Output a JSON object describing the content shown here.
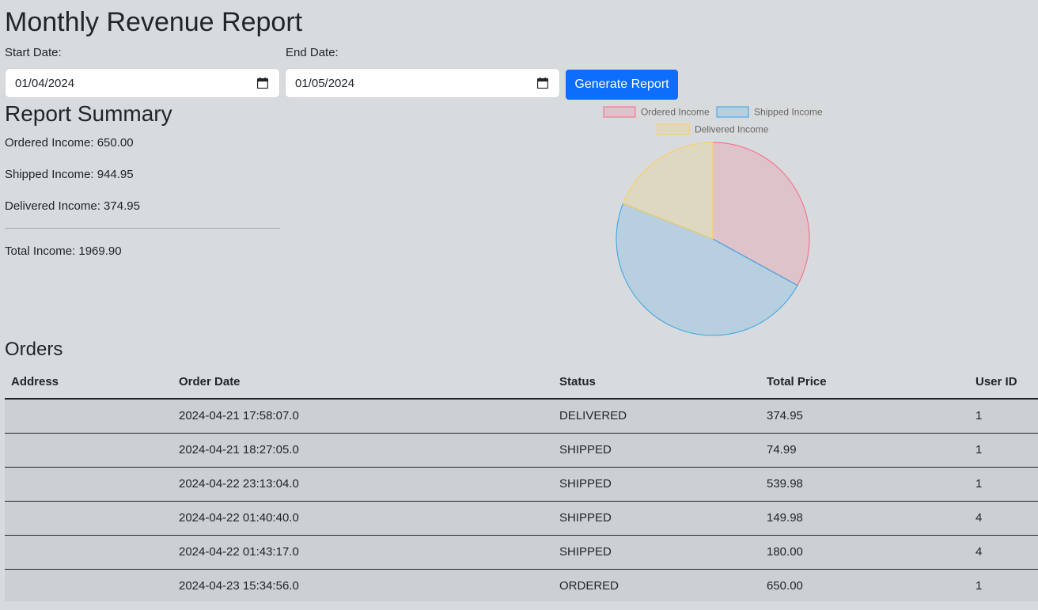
{
  "header": {
    "title": "Monthly Revenue Report"
  },
  "filters": {
    "start_label": "Start Date:",
    "start_value": "01/04/2024",
    "end_label": "End Date:",
    "end_value": "01/05/2024",
    "generate_label": "Generate Report"
  },
  "summary": {
    "title": "Report Summary",
    "ordered": "Ordered Income: 650.00",
    "shipped": "Shipped Income: 944.95",
    "delivered": "Delivered Income: 374.95",
    "total": "Total Income: 1969.90"
  },
  "chart_data": {
    "type": "pie",
    "categories": [
      "Ordered Income",
      "Shipped Income",
      "Delivered Income"
    ],
    "values": [
      650.0,
      944.95,
      374.95
    ],
    "colors": [
      "#ff6384",
      "#36a2eb",
      "#ffcd56"
    ],
    "fill_colors": [
      "rgba(255,99,132,0.2)",
      "rgba(54,162,235,0.2)",
      "rgba(255,205,86,0.2)"
    ],
    "legend_position": "top"
  },
  "orders": {
    "title": "Orders",
    "columns": [
      "Address",
      "Order Date",
      "Status",
      "Total Price",
      "User ID"
    ],
    "rows": [
      {
        "address": "",
        "order_date": "2024-04-21 17:58:07.0",
        "status": "DELIVERED",
        "total_price": "374.95",
        "user_id": "1"
      },
      {
        "address": "",
        "order_date": "2024-04-21 18:27:05.0",
        "status": "SHIPPED",
        "total_price": "74.99",
        "user_id": "1"
      },
      {
        "address": "",
        "order_date": "2024-04-22 23:13:04.0",
        "status": "SHIPPED",
        "total_price": "539.98",
        "user_id": "1"
      },
      {
        "address": "",
        "order_date": "2024-04-22 01:40:40.0",
        "status": "SHIPPED",
        "total_price": "149.98",
        "user_id": "4"
      },
      {
        "address": "",
        "order_date": "2024-04-22 01:43:17.0",
        "status": "SHIPPED",
        "total_price": "180.00",
        "user_id": "4"
      },
      {
        "address": "",
        "order_date": "2024-04-23 15:34:56.0",
        "status": "ORDERED",
        "total_price": "650.00",
        "user_id": "1"
      }
    ]
  }
}
